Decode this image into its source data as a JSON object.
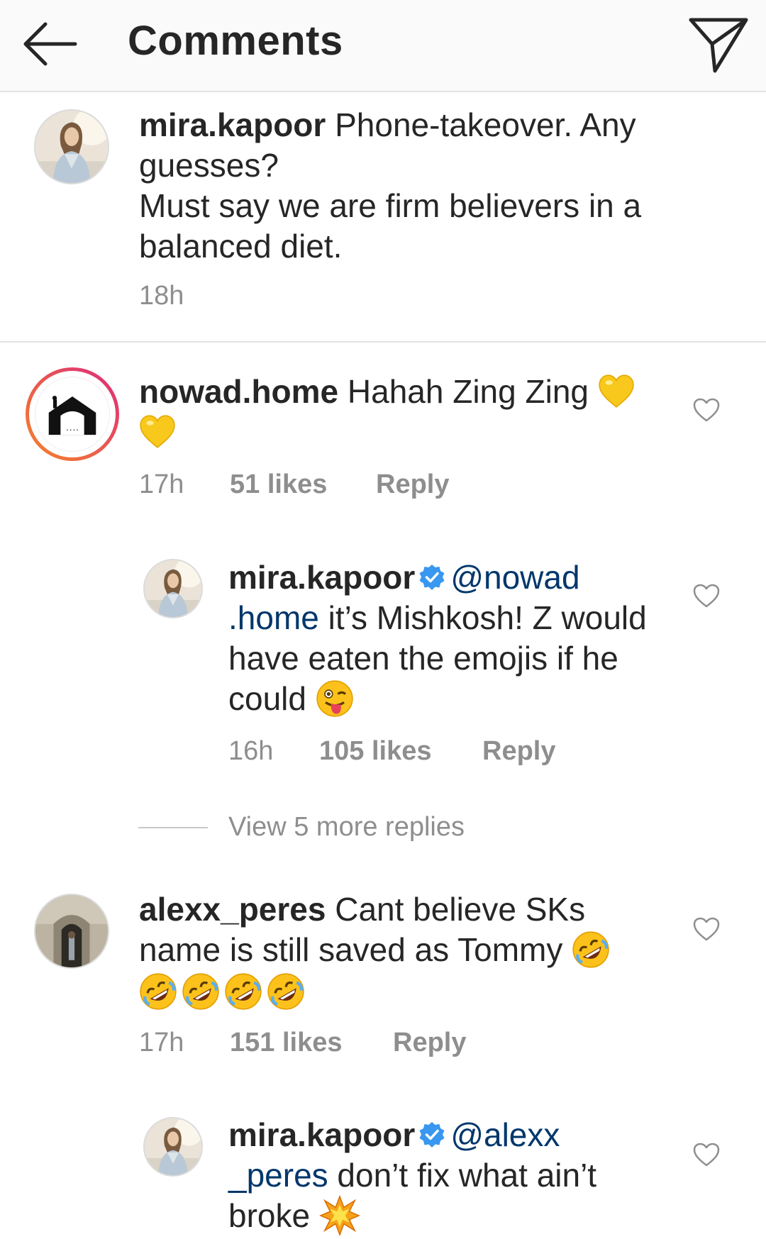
{
  "header": {
    "title": "Comments",
    "back_icon": "arrow-left-icon",
    "send_icon": "paper-plane-icon"
  },
  "caption": {
    "username": "mira.kapoor",
    "text_line1": " Phone-takeover. Any guesses?",
    "text_line2": "Must say we are firm believers in a balanced diet.",
    "time": "18h"
  },
  "comments": [
    {
      "username": "nowad.home",
      "text": " Hahah Zing Zing ",
      "emojis": [
        "yellow-heart",
        "yellow-heart"
      ],
      "time": "17h",
      "likes": "51 likes",
      "reply": "Reply",
      "replies": [
        {
          "username": "mira.kapoor",
          "verified": true,
          "mention": "@nowad .home",
          "text": " it’s Mishkosh! Z would have eaten the emojis if he could ",
          "emojis": [
            "winking-tongue-face"
          ],
          "time": "16h",
          "likes": "105 likes",
          "reply": "Reply"
        }
      ],
      "view_more": "View 5 more replies"
    },
    {
      "username": "alexx_peres",
      "text": " Cant believe SKs name is still saved as Tommy ",
      "emojis": [
        "rolling-laughing-face",
        "rolling-laughing-face",
        "rolling-laughing-face",
        "rolling-laughing-face",
        "rolling-laughing-face"
      ],
      "time": "17h",
      "likes": "151 likes",
      "reply": "Reply",
      "replies": [
        {
          "username": "mira.kapoor",
          "verified": true,
          "mention": "@alexx _peres",
          "text": " don’t fix what ain’t broke ",
          "emojis": [
            "collision"
          ]
        }
      ]
    }
  ],
  "colors": {
    "mention": "#00376b",
    "meta": "#8e8e8e",
    "verified": "#3897f0",
    "story_ring_start": "#f58529",
    "story_ring_end": "#dd2a7b"
  }
}
